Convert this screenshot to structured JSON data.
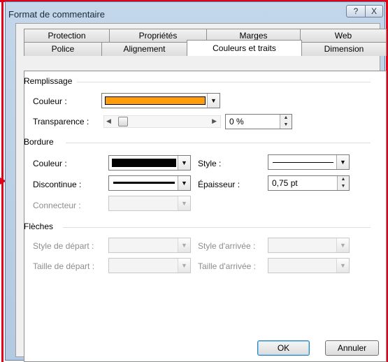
{
  "window": {
    "title": "Format de commentaire",
    "help_label": "?",
    "close_label": "X"
  },
  "tabs_row1": [
    {
      "label": "Protection"
    },
    {
      "label": "Propriétés"
    },
    {
      "label": "Marges"
    },
    {
      "label": "Web"
    }
  ],
  "tabs_row2": [
    {
      "label": "Police"
    },
    {
      "label": "Alignement"
    },
    {
      "label": "Couleurs et traits",
      "active": true
    },
    {
      "label": "Dimension"
    }
  ],
  "fill": {
    "section": "Remplissage",
    "color_label": "Couleur :",
    "color_value": "#ff9d0a",
    "transparency_label": "Transparence :",
    "transparency_value": "0 %"
  },
  "border": {
    "section": "Bordure",
    "color_label": "Couleur :",
    "color_value": "#000000",
    "style_label": "Style :",
    "dash_label": "Discontinue :",
    "weight_label": "Épaisseur :",
    "weight_value": "0,75 pt",
    "connector_label": "Connecteur :"
  },
  "arrows": {
    "section": "Flèches",
    "begin_style_label": "Style de départ :",
    "end_style_label": "Style d'arrivée :",
    "begin_size_label": "Taille de départ :",
    "end_size_label": "Taille d'arrivée :"
  },
  "buttons": {
    "ok": "OK",
    "cancel": "Annuler"
  },
  "colors": {
    "accent_highlight": "#e0001a",
    "title_bar": "#c3d6ea"
  }
}
